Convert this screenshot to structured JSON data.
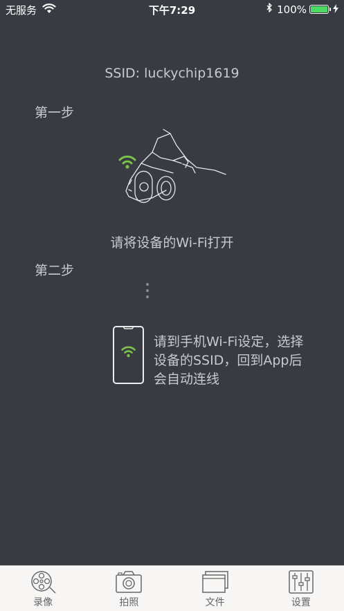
{
  "status_bar": {
    "carrier": "无服务",
    "time": "下午7:29",
    "battery_percent": "100%",
    "battery_level": 1.0,
    "battery_color": "#4cd964"
  },
  "main": {
    "ssid": "SSID: luckychip1619",
    "step1_label": "第一步",
    "step1_instruction": "请将设备的Wi-Fi打开",
    "step2_label": "第二步",
    "step2_instruction": "请到手机Wi-Fi设定，选择设备的SSID，回到App后会自动连线",
    "wifi_color": "#7cc24b"
  },
  "tab_bar": {
    "tabs": [
      {
        "label": "录像",
        "icon": "film-reel-icon"
      },
      {
        "label": "拍照",
        "icon": "camera-icon"
      },
      {
        "label": "文件",
        "icon": "folder-icon"
      },
      {
        "label": "设置",
        "icon": "sliders-icon"
      }
    ]
  }
}
